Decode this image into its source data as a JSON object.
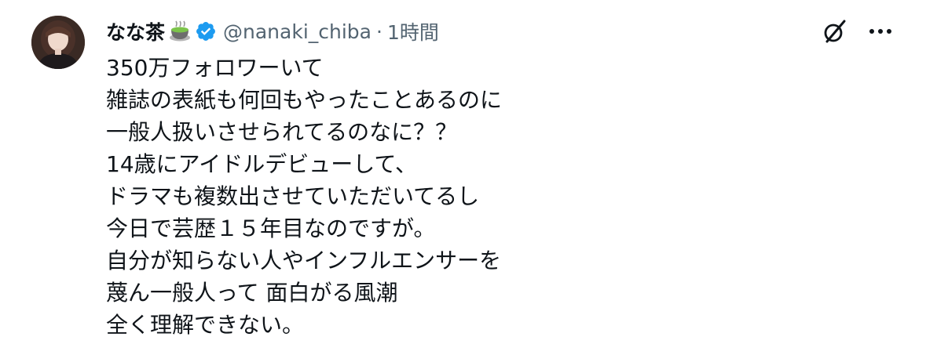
{
  "tweet": {
    "display_name": "なな茶",
    "handle": "@nanaki_chiba",
    "separator": "·",
    "time": "1時間",
    "lines": [
      "350万フォロワーいて",
      "雑誌の表紙も何回もやったことあるのに",
      "一般人扱いさせられてるのなに？？",
      "14歳にアイドルデビューして、",
      "ドラマも複数出させていただいてるし",
      "今日で芸歴１５年目なのですが。",
      "自分が知らない人やインフルエンサーを",
      "蔑ん一般人って 面白がる風潮",
      "全く理解できない。"
    ]
  },
  "icons": {
    "emoji": "matcha-tea-emoji",
    "verified": "verified-badge-icon",
    "grok": "grok-icon",
    "more": "more-options-icon"
  },
  "colors": {
    "text": "#0f1419",
    "secondary": "#536471",
    "verified": "#1d9bf0"
  }
}
